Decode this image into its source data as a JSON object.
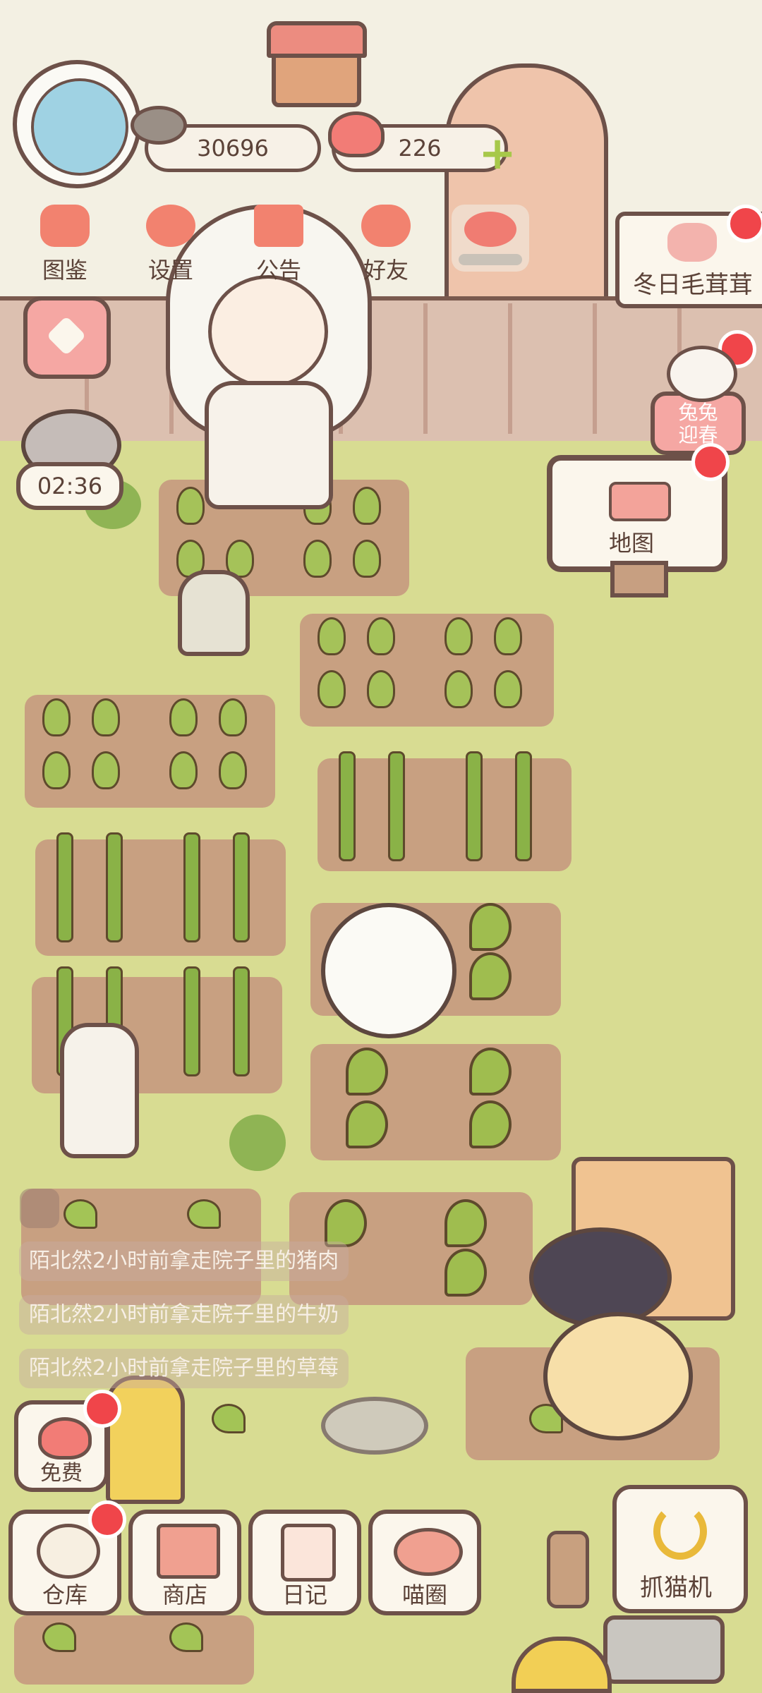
{
  "resources": {
    "fish_icon": "fish-icon",
    "fish_count": "30696",
    "heart_icon": "heart-icon",
    "heart_count": "226",
    "add_icon": "plus-icon"
  },
  "top_menu": [
    {
      "icon": "cat-book-icon",
      "label": "图鉴"
    },
    {
      "icon": "gear-icon",
      "label": "设置"
    },
    {
      "icon": "gift-icon",
      "label": "公告"
    },
    {
      "icon": "friends-icon",
      "label": "好友"
    }
  ],
  "event_banner": {
    "label": "冬日毛茸茸"
  },
  "bunny_event": {
    "label_line1": "兔兔",
    "label_line2": "迎春"
  },
  "timer": {
    "value": "02:36"
  },
  "map_sign": {
    "label": "地图"
  },
  "activity_feed": [
    "陌北然2小时前拿走院子里的猪肉",
    "陌北然2小时前拿走院子里的牛奶",
    "陌北然2小时前拿走院子里的草莓"
  ],
  "free_button": {
    "label": "免费"
  },
  "bottom_nav": [
    {
      "icon": "warehouse-icon",
      "label": "仓库"
    },
    {
      "icon": "shop-icon",
      "label": "商店"
    },
    {
      "icon": "diary-icon",
      "label": "日记"
    },
    {
      "icon": "cat-planet-icon",
      "label": "喵圈"
    }
  ],
  "claw_machine": {
    "label": "抓猫机"
  },
  "colors": {
    "accent": "#f2826f",
    "badge": "#f0454a",
    "outline": "#6d5149",
    "grass": "#d8dc92"
  }
}
